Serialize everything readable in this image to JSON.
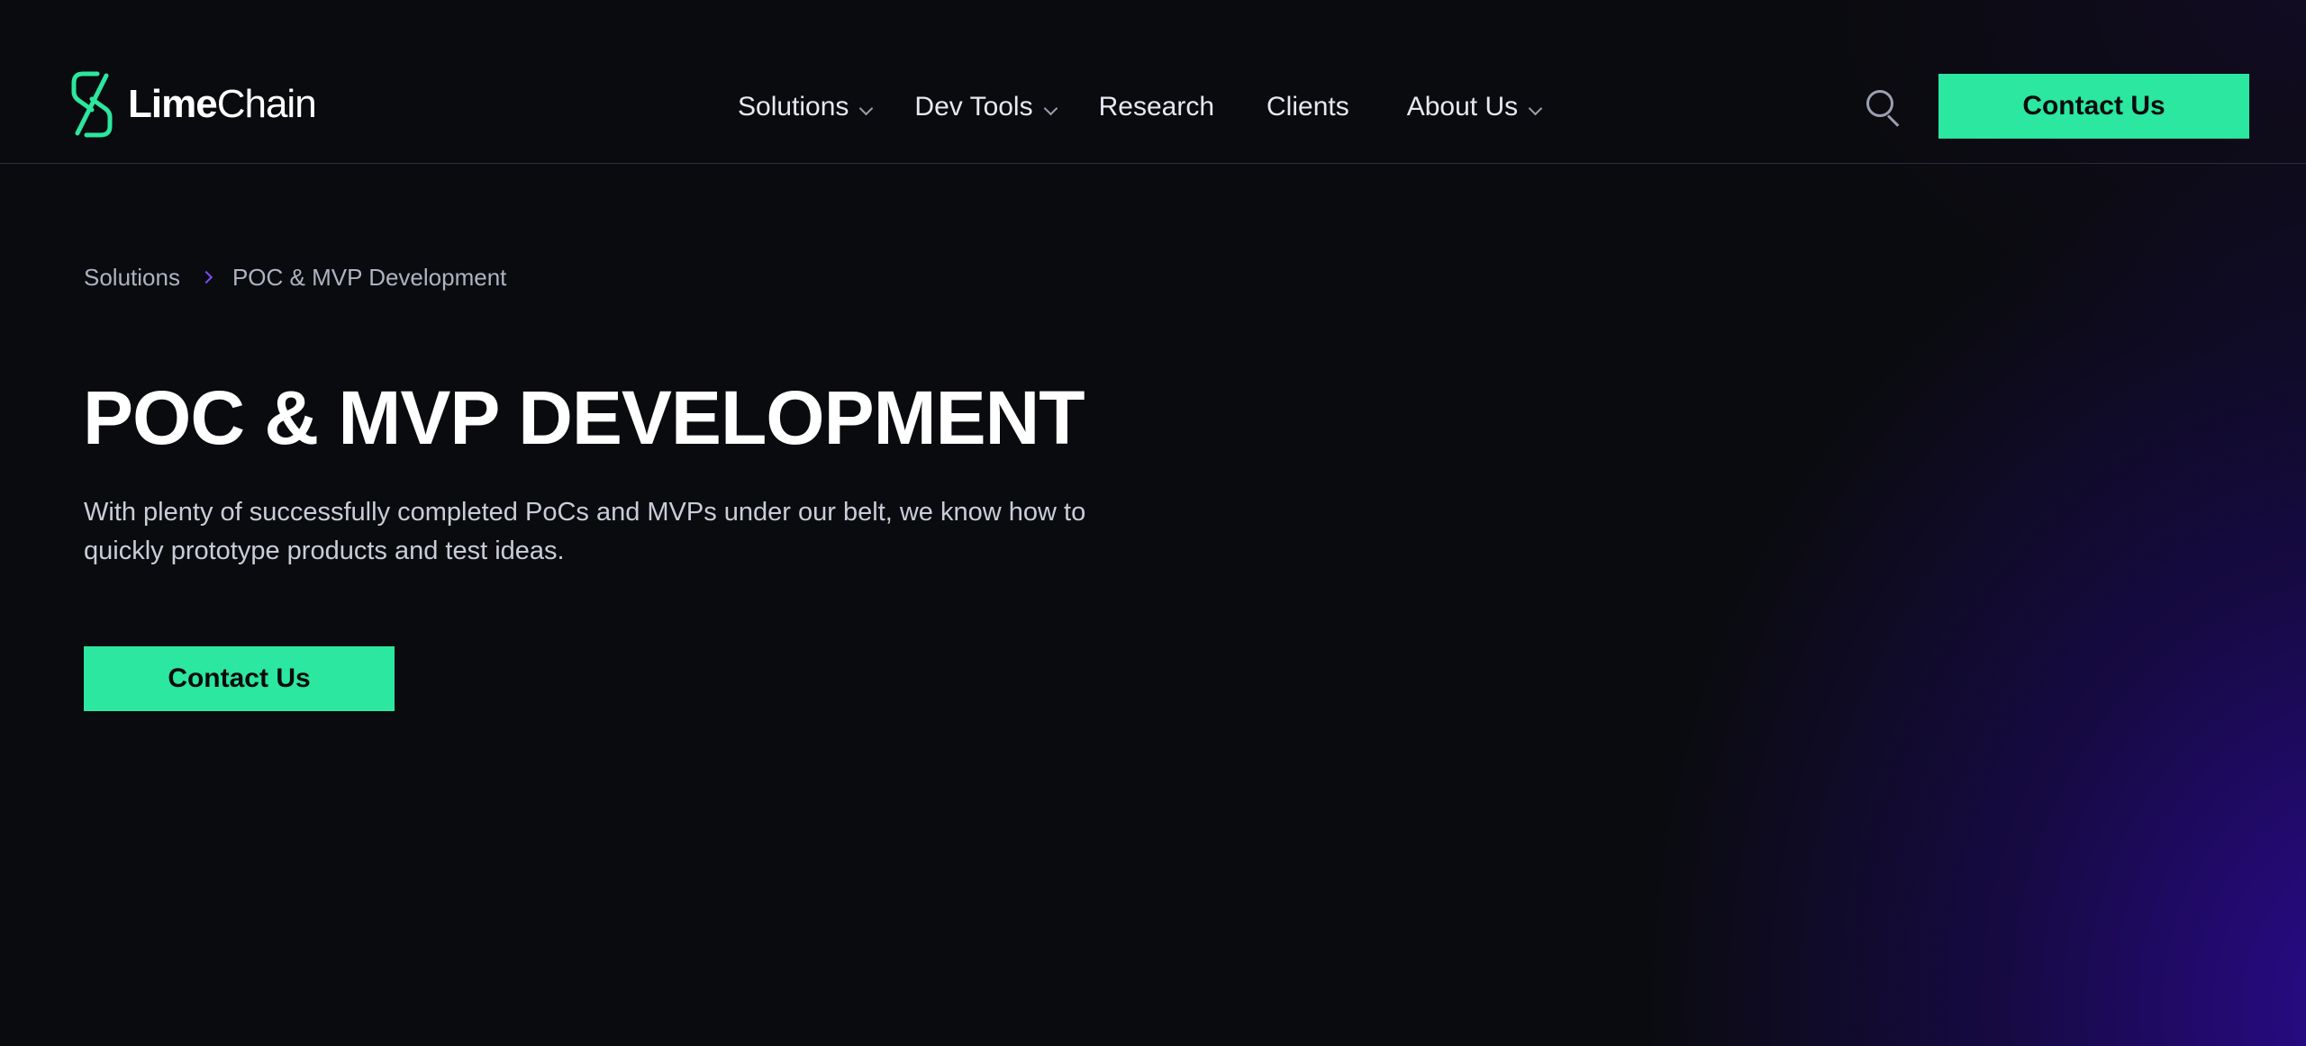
{
  "brand": {
    "name_bold": "Lime",
    "name_light": "Chain",
    "icon": "limechain-logo-icon",
    "accent_color": "#2be79f"
  },
  "nav": {
    "items": [
      {
        "label": "Solutions",
        "has_dropdown": true
      },
      {
        "label": "Dev Tools",
        "has_dropdown": true
      },
      {
        "label": "Research",
        "has_dropdown": false
      },
      {
        "label": "Clients",
        "has_dropdown": false
      },
      {
        "label": "About Us",
        "has_dropdown": true
      }
    ],
    "search_icon": "search-icon",
    "contact_label": "Contact Us"
  },
  "breadcrumb": {
    "parent": "Solutions",
    "current": "POC & MVP Development",
    "separator_icon": "chevron-right-icon"
  },
  "hero": {
    "title": "POC & MVP DEVELOPMENT",
    "description": "With plenty of successfully completed PoCs and MVPs under our belt, we know how to quickly prototype products and test ideas.",
    "cta_label": "Contact Us"
  },
  "colors": {
    "background": "#0a0b0e",
    "glow": "#2c0a96",
    "breadcrumb_separator": "#7a4bff"
  }
}
